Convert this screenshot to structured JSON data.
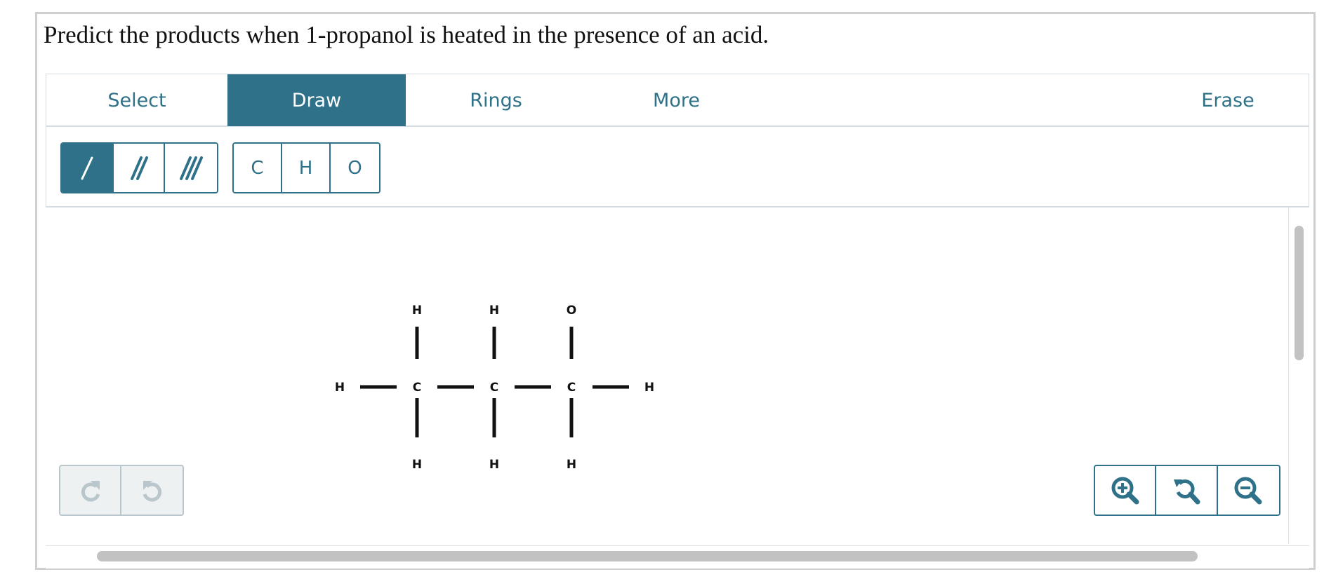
{
  "question": "Predict the products when 1-propanol is heated in the presence of an acid.",
  "tabs": {
    "select": "Select",
    "draw": "Draw",
    "rings": "Rings",
    "more": "More",
    "erase": "Erase",
    "active": "Draw"
  },
  "tools": {
    "bonds": [
      {
        "name": "single-bond",
        "icon": "single-bond-icon",
        "active": true
      },
      {
        "name": "double-bond",
        "icon": "double-bond-icon",
        "active": false
      },
      {
        "name": "triple-bond",
        "icon": "triple-bond-icon",
        "active": false
      }
    ],
    "atoms": [
      "C",
      "H",
      "O"
    ]
  },
  "molecule": {
    "atoms": {
      "h_top_1": "H",
      "h_top_2": "H",
      "o_top": "O",
      "h_left": "H",
      "c1": "C",
      "c2": "C",
      "c3": "C",
      "h_right": "H",
      "h_bot_1": "H",
      "h_bot_2": "H",
      "h_bot_3": "H"
    }
  },
  "history": {
    "redo_icon": "redo-icon",
    "undo_icon": "undo-icon"
  },
  "zoom": {
    "in_icon": "zoom-in-icon",
    "reset_icon": "zoom-reset-icon",
    "out_icon": "zoom-out-icon"
  },
  "colors": {
    "accent": "#2e7189",
    "border": "#d6dde2",
    "disabled": "#b9c6cc",
    "scrollbar": "#c2c2c2"
  }
}
